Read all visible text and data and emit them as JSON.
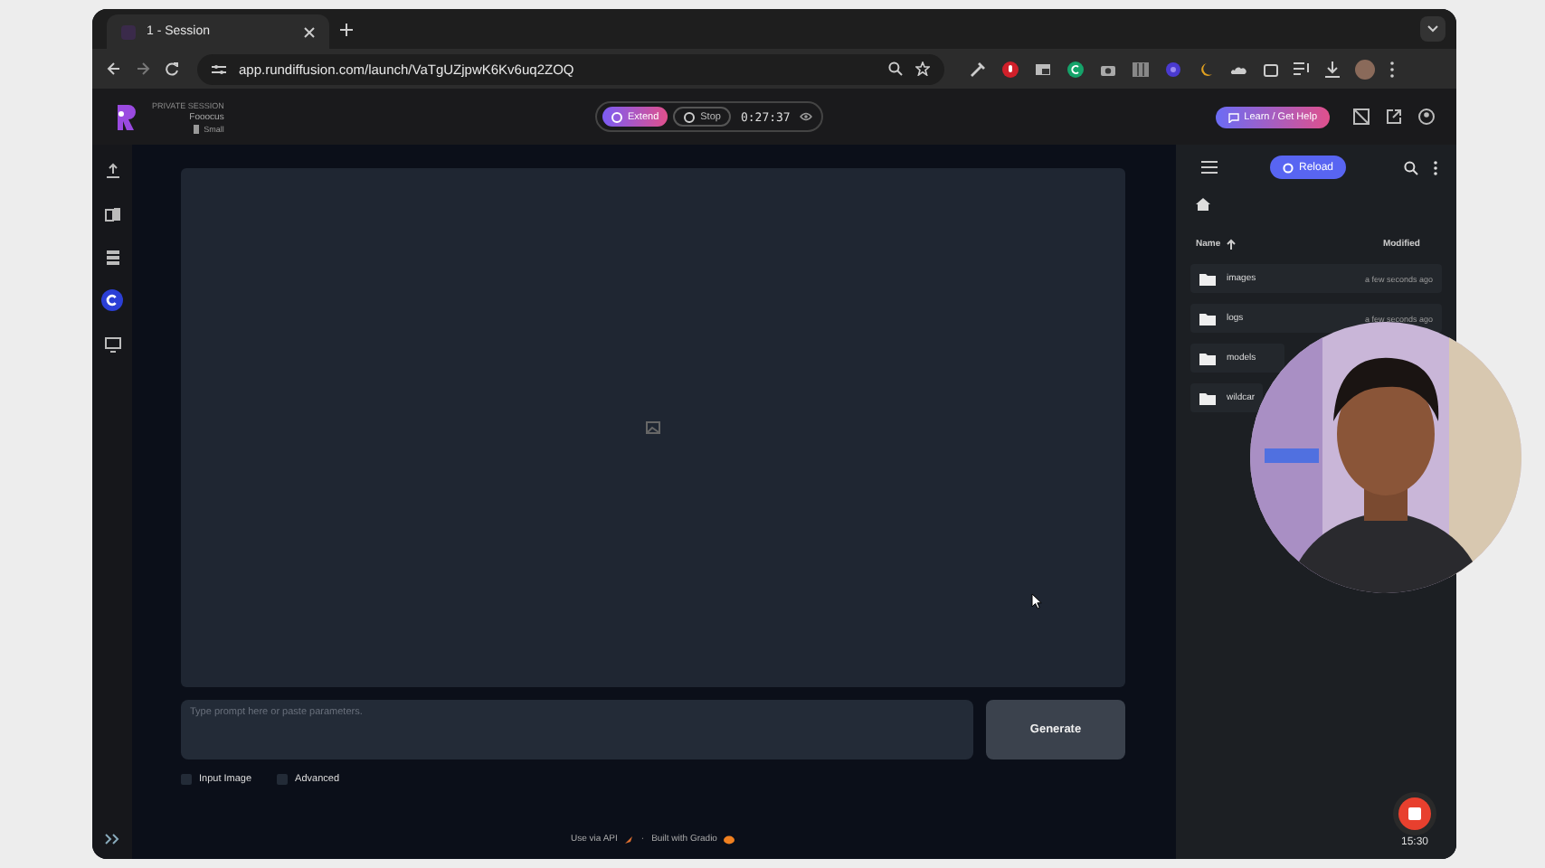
{
  "browser": {
    "tab": {
      "title": "1 - Session",
      "selected": true
    },
    "url": "app.rundiffusion.com/launch/VaTgUZjpwK6Kv6uq2ZOQ",
    "extensions": [
      {
        "kind": "eyedropper"
      },
      {
        "kind": "mic"
      },
      {
        "kind": "window"
      },
      {
        "kind": "grammar"
      },
      {
        "kind": "camera"
      },
      {
        "kind": "grid"
      },
      {
        "kind": "dot"
      },
      {
        "kind": "moon"
      },
      {
        "kind": "cloud"
      },
      {
        "kind": "puzzle"
      }
    ]
  },
  "header": {
    "session_label": "PRIVATE SESSION",
    "app_name": "Fooocus",
    "size": "Small",
    "extend": "Extend",
    "stop": "Stop",
    "timer": "0:27:37",
    "help": "Learn / Get Help"
  },
  "rail": [
    {
      "kind": "upload",
      "selected": false
    },
    {
      "kind": "book",
      "selected": false
    },
    {
      "kind": "stack",
      "selected": false
    },
    {
      "kind": "circle",
      "selected": true
    },
    {
      "kind": "monitor",
      "selected": false
    }
  ],
  "prompt": {
    "placeholder": "Type prompt here or paste parameters."
  },
  "generate": "Generate",
  "options": [
    {
      "label": "Input Image",
      "checked": false
    },
    {
      "label": "Advanced",
      "checked": false
    }
  ],
  "footer": {
    "api": "Use via API",
    "separator": "·",
    "built": "Built with Gradio"
  },
  "files": {
    "reload": "Reload",
    "columns": [
      "Name",
      "Modified"
    ],
    "rows": [
      {
        "name": "images",
        "modified": "a few seconds ago"
      },
      {
        "name": "logs",
        "modified": "a few seconds ago"
      },
      {
        "name": "models"
      },
      {
        "name": "wildcar"
      }
    ]
  },
  "recorder": {
    "time": "15:30"
  }
}
